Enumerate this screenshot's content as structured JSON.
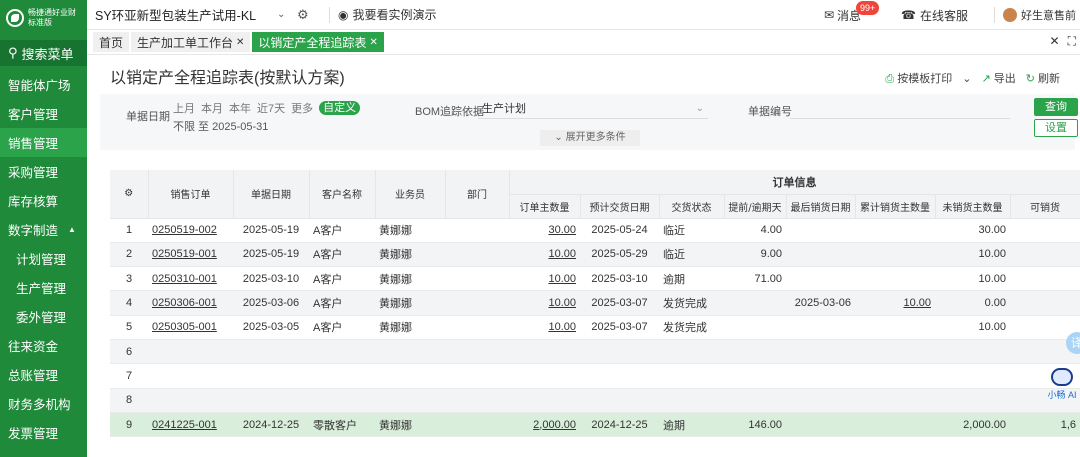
{
  "app": {
    "logo_line1": "畅捷通好业财",
    "logo_line2": "标准版",
    "company": "SY环亚新型包装生产试用-KL",
    "demo_label": "我要看实例演示",
    "messages_label": "消息",
    "messages_badge": "99+",
    "service_label": "在线客服",
    "user_name": "好生意售前"
  },
  "sidebar": {
    "search_label": "搜索菜单",
    "items": [
      {
        "label": "智能体广场"
      },
      {
        "label": "客户管理"
      },
      {
        "label": "销售管理"
      },
      {
        "label": "采购管理"
      },
      {
        "label": "库存核算"
      },
      {
        "label": "数字制造"
      },
      {
        "label": "计划管理"
      },
      {
        "label": "生产管理"
      },
      {
        "label": "委外管理"
      },
      {
        "label": "往来资金"
      },
      {
        "label": "总账管理"
      },
      {
        "label": "财务多机构"
      },
      {
        "label": "发票管理"
      }
    ]
  },
  "tabs": [
    {
      "label": "首页"
    },
    {
      "label": "生产加工单工作台"
    },
    {
      "label": "以销定产全程追踪表"
    }
  ],
  "page": {
    "title": "以销定产全程追踪表(按默认方案)",
    "print_label": "按模板打印",
    "export_label": "导出",
    "refresh_label": "刷新"
  },
  "filter": {
    "date_label": "单据日期",
    "periods": [
      "上月",
      "本月",
      "本年",
      "近7天",
      "更多"
    ],
    "custom_label": "自定义",
    "range_text": "不限 至 2025-05-31",
    "bom_label": "BOM追踪依据",
    "bom_value": "生产计划",
    "docno_label": "单据编号",
    "expand_label": "展开更多条件",
    "query_label": "查询",
    "settings_label": "设置"
  },
  "table": {
    "group_header": "订单信息",
    "headers": {
      "order": "销售订单",
      "date": "单据日期",
      "customer": "客户名称",
      "salesman": "业务员",
      "dept": "部门",
      "qty": "订单主数量",
      "expected": "预计交货日期",
      "status": "交货状态",
      "days": "提前/逾期天",
      "last_date": "最后销货日期",
      "cum_qty": "累计销货主数量",
      "unsold": "未销货主数量",
      "available": "可销货"
    },
    "rows": [
      {
        "no": "1",
        "order": "0250519-002",
        "date": "2025-05-19",
        "customer": "A客户",
        "salesman": "黄娜娜",
        "qty": "30.00",
        "expected": "2025-05-24",
        "status": "临近",
        "status_type": "normal",
        "days": "4.00",
        "last_date": "",
        "cum_qty": "",
        "unsold": "30.00",
        "available": ""
      },
      {
        "no": "2",
        "order": "0250519-001",
        "date": "2025-05-19",
        "customer": "A客户",
        "salesman": "黄娜娜",
        "qty": "10.00",
        "expected": "2025-05-29",
        "status": "临近",
        "status_type": "normal",
        "days": "9.00",
        "last_date": "",
        "cum_qty": "",
        "unsold": "10.00",
        "available": ""
      },
      {
        "no": "3",
        "order": "0250310-001",
        "date": "2025-03-10",
        "customer": "A客户",
        "salesman": "黄娜娜",
        "qty": "10.00",
        "expected": "2025-03-10",
        "status": "逾期",
        "status_type": "overdue",
        "days": "71.00",
        "last_date": "",
        "cum_qty": "",
        "unsold": "10.00",
        "available": ""
      },
      {
        "no": "4",
        "order": "0250306-001",
        "date": "2025-03-06",
        "customer": "A客户",
        "salesman": "黄娜娜",
        "qty": "10.00",
        "expected": "2025-03-07",
        "status": "发货完成",
        "status_type": "normal",
        "days": "",
        "last_date": "2025-03-06",
        "cum_qty": "10.00",
        "unsold": "0.00",
        "available": ""
      },
      {
        "no": "5",
        "order": "0250305-001",
        "date": "2025-03-05",
        "customer": "A客户",
        "salesman": "黄娜娜",
        "qty": "10.00",
        "expected": "2025-03-07",
        "status": "发货完成",
        "status_type": "normal",
        "days": "",
        "last_date": "",
        "cum_qty": "",
        "unsold": "10.00",
        "available": ""
      },
      {
        "no": "6",
        "order": "",
        "date": "",
        "customer": "",
        "salesman": "",
        "qty": "",
        "expected": "",
        "status": "",
        "status_type": "normal",
        "days": "",
        "last_date": "",
        "cum_qty": "",
        "unsold": "",
        "available": ""
      },
      {
        "no": "7",
        "order": "",
        "date": "",
        "customer": "",
        "salesman": "",
        "qty": "",
        "expected": "",
        "status": "",
        "status_type": "normal",
        "days": "",
        "last_date": "",
        "cum_qty": "",
        "unsold": "",
        "available": ""
      },
      {
        "no": "8",
        "order": "",
        "date": "",
        "customer": "",
        "salesman": "",
        "qty": "",
        "expected": "",
        "status": "",
        "status_type": "normal",
        "days": "",
        "last_date": "",
        "cum_qty": "",
        "unsold": "",
        "available": ""
      },
      {
        "no": "9",
        "order": "0241225-001",
        "date": "2024-12-25",
        "customer": "零散客户",
        "salesman": "黄娜娜",
        "qty": "2,000.00",
        "expected": "2024-12-25",
        "status": "逾期",
        "status_type": "overdue",
        "days": "146.00",
        "last_date": "",
        "cum_qty": "",
        "unsold": "2,000.00",
        "available": "1,6"
      }
    ]
  },
  "floating": {
    "translate": "译",
    "ai_label": "小畅 AI"
  },
  "colors": {
    "brand_green": "#1f8a3a",
    "active_green": "#2aa34a",
    "overdue_purple": "#9a4fc8",
    "badge_red": "#f0453a",
    "highlight_row": "#d9eedb"
  }
}
